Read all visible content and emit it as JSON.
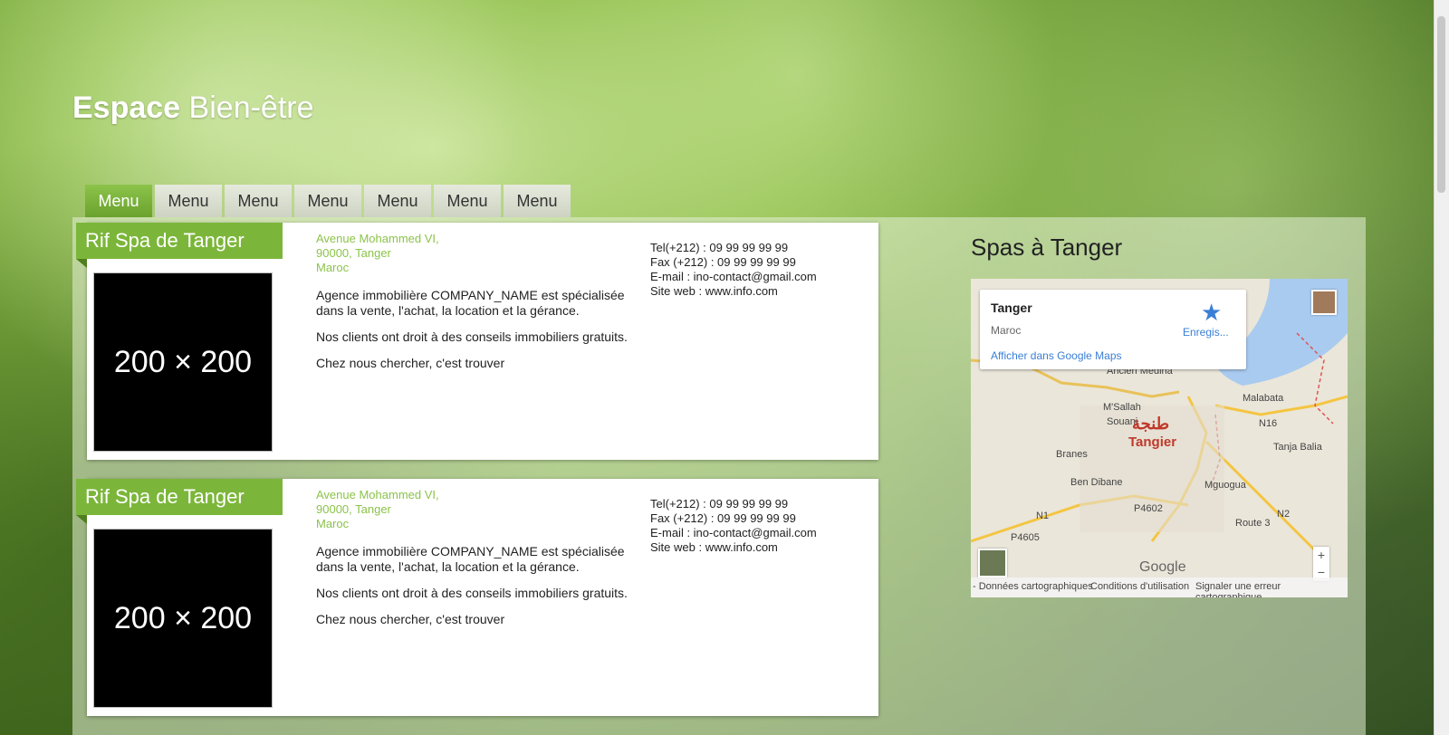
{
  "brand": {
    "bold": "Espace",
    "light": "Bien-être"
  },
  "nav": {
    "tabs": [
      "Menu",
      "Menu",
      "Menu",
      "Menu",
      "Menu",
      "Menu",
      "Menu"
    ]
  },
  "cards": [
    {
      "title": "Rif Spa de Tanger",
      "thumb": "200 × 200",
      "address": [
        "Avenue Mohammed VI,",
        "90000, Tanger",
        "Maroc"
      ],
      "desc": [
        "Agence immobilière COMPANY_NAME est spécialisée dans la vente, l'achat, la location et la gérance.",
        "Nos clients ont droit à des conseils immobiliers gratuits.",
        "Chez nous chercher, c'est trouver"
      ],
      "contact": [
        "Tel(+212) : 09 99 99 99 99",
        "Fax (+212) : 09 99 99 99 99",
        "E-mail : ino-contact@gmail.com",
        "Site web : www.info.com"
      ]
    },
    {
      "title": "Rif Spa de Tanger",
      "thumb": "200 × 200",
      "address": [
        "Avenue Mohammed VI,",
        "90000, Tanger",
        "Maroc"
      ],
      "desc": [
        "Agence immobilière COMPANY_NAME est spécialisée dans la vente, l'achat, la location et la gérance.",
        "Nos clients ont droit à des conseils immobiliers gratuits.",
        "Chez nous chercher, c'est trouver"
      ],
      "contact": [
        "Tel(+212) : 09 99 99 99 99",
        "Fax (+212) : 09 99 99 99 99",
        "E-mail : ino-contact@gmail.com",
        "Site web : www.info.com"
      ]
    }
  ],
  "sidebar": {
    "title": "Spas à Tanger",
    "map": {
      "info_city": "Tanger",
      "info_country": "Maroc",
      "info_save": "Enregis...",
      "info_link": "Afficher dans Google Maps",
      "city_arabic": "طنجة",
      "city_latin": "Tangier",
      "labels": [
        "Ancien Medina",
        "M'Sallah",
        "Souani",
        "Branes",
        "Ben Dibane",
        "Malabata",
        "Tanja Balia",
        "Mguogua",
        "N16",
        "N1",
        "N2",
        "P4605",
        "P4602",
        "Route 3",
        "Google"
      ],
      "zoom_in": "+",
      "zoom_out": "−",
      "footer": [
        "- Données cartographiques",
        "Conditions d'utilisation",
        "Signaler une erreur cartographique"
      ]
    }
  },
  "colors": {
    "accent": "#7bb63a",
    "link": "#3a7fd6"
  }
}
